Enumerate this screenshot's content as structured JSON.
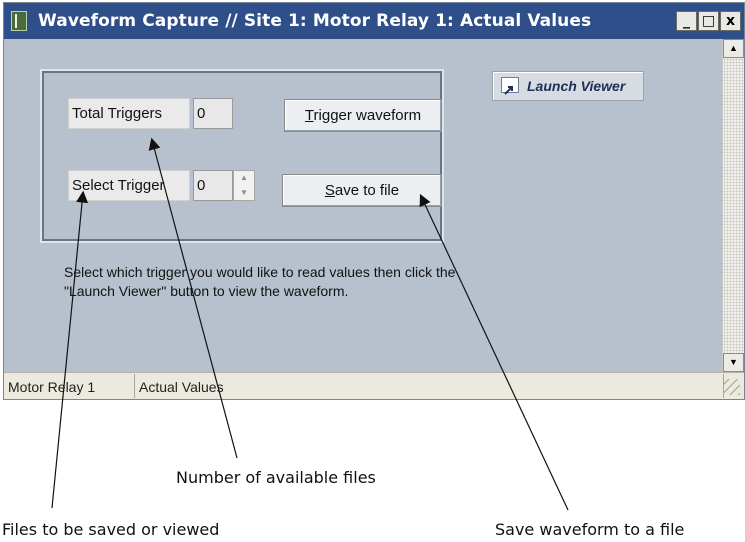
{
  "window": {
    "title": "Waveform Capture // Site 1: Motor Relay 1: Actual Values",
    "controls": {
      "minimize": "_",
      "maximize": "□",
      "close": "x"
    }
  },
  "panel": {
    "total_triggers": {
      "label": "Total Triggers",
      "value": "0"
    },
    "select_trigger": {
      "label": "Select Trigger",
      "value": "0"
    },
    "trigger_button": {
      "mnemonic": "T",
      "rest": "rigger waveform"
    },
    "save_button": {
      "mnemonic": "S",
      "rest": "ave to file"
    },
    "launch_viewer_label": "Launch Viewer",
    "instructions": "Select which trigger you would like to read values then click the \"Launch Viewer\" button to view the waveform."
  },
  "statusbar": {
    "device": "Motor Relay 1",
    "view": "Actual Values"
  },
  "annotations": {
    "available_files": "Number of available files",
    "files_saved_viewed": "Files to be saved or viewed",
    "save_waveform": "Save waveform to a file"
  }
}
